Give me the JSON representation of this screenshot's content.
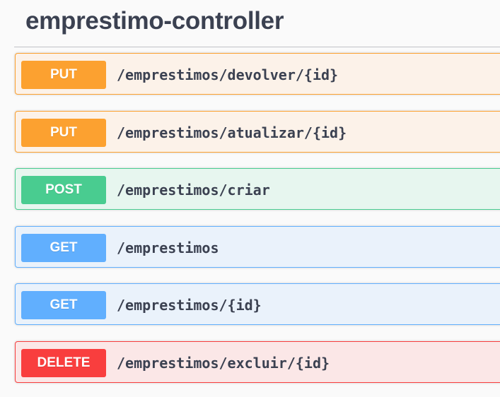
{
  "tag": {
    "title": "emprestimo-controller"
  },
  "operations": [
    {
      "method": "PUT",
      "path": "/emprestimos/devolver/{id}"
    },
    {
      "method": "PUT",
      "path": "/emprestimos/atualizar/{id}"
    },
    {
      "method": "POST",
      "path": "/emprestimos/criar"
    },
    {
      "method": "GET",
      "path": "/emprestimos"
    },
    {
      "method": "GET",
      "path": "/emprestimos/{id}"
    },
    {
      "method": "DELETE",
      "path": "/emprestimos/excluir/{id}"
    }
  ],
  "colors": {
    "put": "#fca130",
    "post": "#49cc90",
    "get": "#61affe",
    "delete": "#f93e3e",
    "text": "#3b4151"
  }
}
